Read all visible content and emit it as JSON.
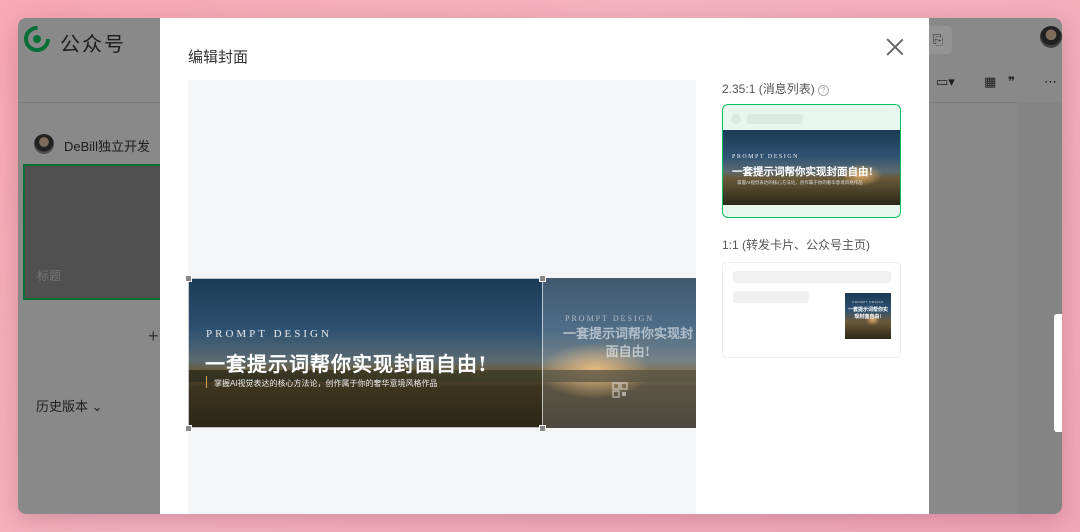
{
  "app": {
    "name": "公众号",
    "account_name": "DeBill独立开发",
    "article_title_placeholder": "标题",
    "add_symbol": "+",
    "history_label": "历史版本",
    "history_chevron": "⌄"
  },
  "toolbar_icons": [
    "text-style-icon",
    "table-icon",
    "quote-icon",
    "more-icon"
  ],
  "modal": {
    "title": "编辑封面",
    "close_icon": "close-icon"
  },
  "cover": {
    "english_title": "PROMPT DESIGN",
    "chinese_title": "一套提示词帮你实现封面自由!",
    "subtitle": "掌握AI视觉表达的核心方法论，创作属于你的奢华意境风格作品",
    "square_english": "PROMPT DESIGN",
    "square_chinese": "一套提示词帮你实现封面自由!"
  },
  "previews": {
    "ratio_wide_label": "2.35:1 (消息列表)",
    "ratio_square_label": "1:1 (转发卡片、公众号主页)"
  },
  "colors": {
    "accent": "#07c160",
    "overlay": "#000000"
  }
}
